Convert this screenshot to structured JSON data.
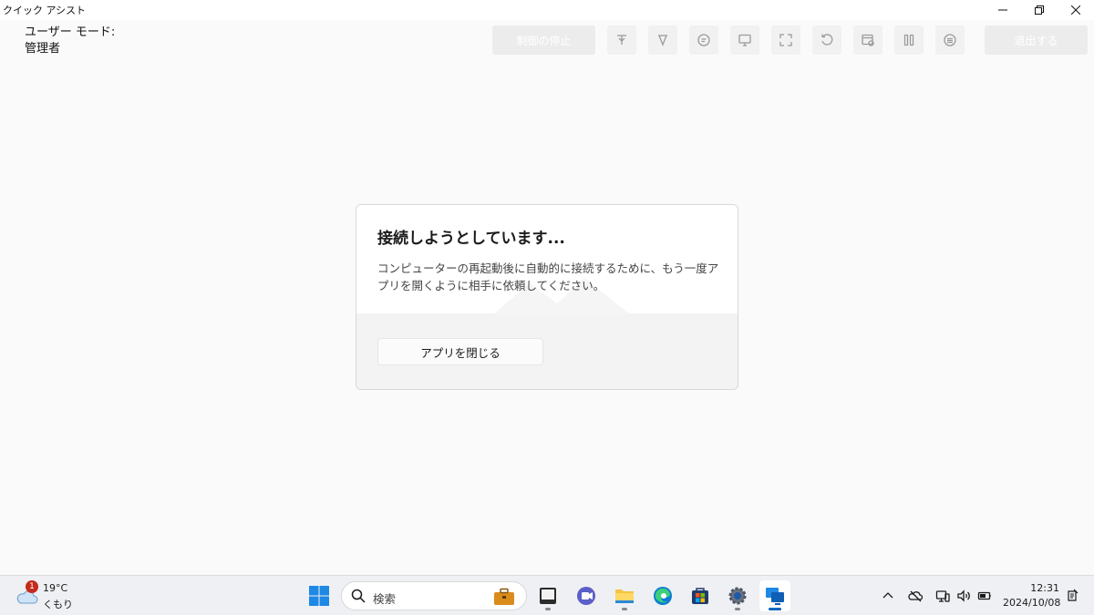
{
  "window": {
    "title": "クイック アシスト"
  },
  "user_mode": {
    "label": "ユーザー モード:",
    "value": "管理者"
  },
  "toolbar": {
    "stop_control_label": "制御の停止",
    "leave_label": "退出する",
    "icons": [
      "laser-pointer-icon",
      "annotate-icon",
      "chat-icon",
      "select-monitor-icon",
      "fullscreen-icon",
      "restart-icon",
      "task-manager-icon",
      "pause-icon",
      "more-icon"
    ]
  },
  "dialog": {
    "title": "接続しようとしています...",
    "message": "コンピューターの再起動後に自動的に接続するために、もう一度アプリを開くように相手に依頼してください。",
    "close_button": "アプリを閉じる"
  },
  "taskbar": {
    "weather": {
      "badge": "1",
      "temperature": "19°C",
      "condition": "くもり"
    },
    "search_placeholder": "検索",
    "apps": [
      "windows-start-icon",
      "work-bag-icon",
      "terminal-icon",
      "teams-icon",
      "file-explorer-icon",
      "edge-icon",
      "store-icon",
      "settings-icon",
      "quick-assist-icon"
    ],
    "tray": [
      "chevron-up-icon",
      "onedrive-icon",
      "device-icon",
      "volume-icon",
      "battery-icon"
    ],
    "clock": {
      "time": "12:31",
      "date": "2024/10/08"
    }
  },
  "colors": {
    "accent": "#0067c0",
    "badge": "#c42b1c",
    "background": "#fafafa"
  }
}
